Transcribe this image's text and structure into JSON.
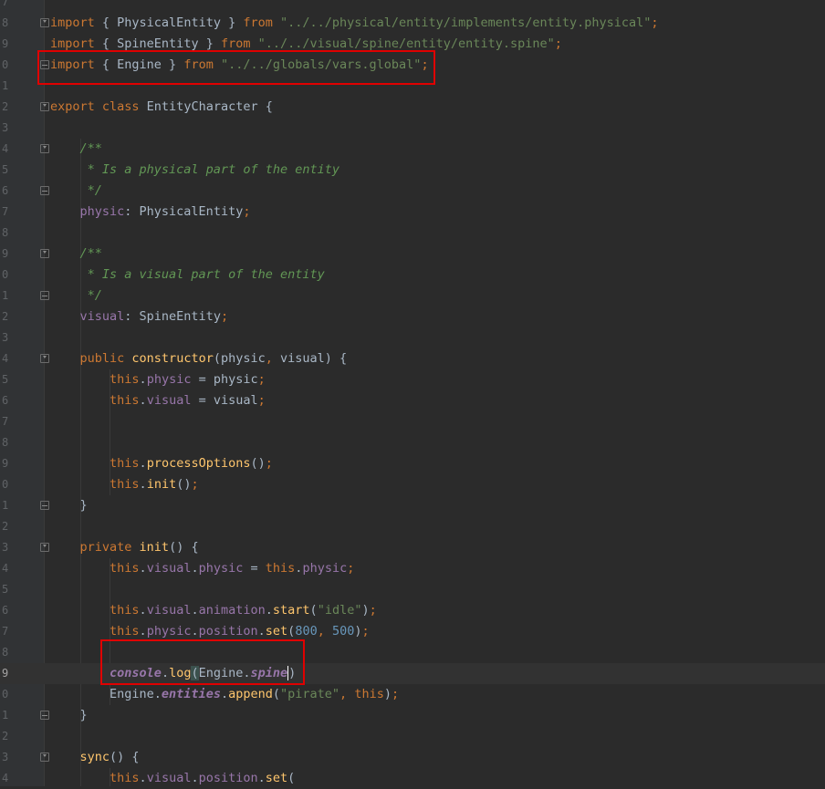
{
  "line_numbers": [
    "7",
    "8",
    "9",
    "0",
    "1",
    "2",
    "3",
    "4",
    "5",
    "6",
    "7",
    "8",
    "9",
    "0",
    "1",
    "2",
    "3",
    "4",
    "5",
    "6",
    "7",
    "8",
    "9",
    "0",
    "1",
    "2",
    "3",
    "4",
    "5",
    "6",
    "7",
    "8",
    "9",
    "0",
    "1",
    "2",
    "3",
    "4"
  ],
  "lines": [
    [],
    [
      [
        "kw",
        "import"
      ],
      [
        "txt",
        " { PhysicalEntity } "
      ],
      [
        "kw",
        "from"
      ],
      [
        "txt",
        " "
      ],
      [
        "str",
        "\"../../physical/entity/implements/entity.physical\""
      ],
      [
        "kw",
        ";"
      ]
    ],
    [
      [
        "kw",
        "import"
      ],
      [
        "txt",
        " { SpineEntity } "
      ],
      [
        "kw",
        "from"
      ],
      [
        "txt",
        " "
      ],
      [
        "str",
        "\"../../visual/spine/entity/entity.spine\""
      ],
      [
        "kw",
        ";"
      ]
    ],
    [
      [
        "kw",
        "import"
      ],
      [
        "txt",
        " { Engine } "
      ],
      [
        "kw",
        "from"
      ],
      [
        "txt",
        " "
      ],
      [
        "str",
        "\"../../globals/vars.global\""
      ],
      [
        "kw",
        ";"
      ]
    ],
    [],
    [
      [
        "kw",
        "export class"
      ],
      [
        "txt",
        " EntityCharacter {"
      ]
    ],
    [],
    [
      [
        "cm",
        "    /**"
      ]
    ],
    [
      [
        "cm",
        "     * Is a physical part of the entity"
      ]
    ],
    [
      [
        "cm",
        "     */"
      ]
    ],
    [
      [
        "fld",
        "    physic"
      ],
      [
        "txt",
        ": PhysicalEntity"
      ],
      [
        "kw",
        ";"
      ]
    ],
    [],
    [
      [
        "cm",
        "    /**"
      ]
    ],
    [
      [
        "cm",
        "     * Is a visual part of the entity"
      ]
    ],
    [
      [
        "cm",
        "     */"
      ]
    ],
    [
      [
        "fld",
        "    visual"
      ],
      [
        "txt",
        ": SpineEntity"
      ],
      [
        "kw",
        ";"
      ]
    ],
    [],
    [
      [
        "kw",
        "    public"
      ],
      [
        "txt",
        " "
      ],
      [
        "fn",
        "constructor"
      ],
      [
        "txt",
        "(physic"
      ],
      [
        "kw",
        ","
      ],
      [
        "txt",
        " visual) {"
      ]
    ],
    [
      [
        "kw",
        "        this"
      ],
      [
        "txt",
        "."
      ],
      [
        "fld",
        "physic"
      ],
      [
        "txt",
        " = physic"
      ],
      [
        "kw",
        ";"
      ]
    ],
    [
      [
        "kw",
        "        this"
      ],
      [
        "txt",
        "."
      ],
      [
        "fld",
        "visual"
      ],
      [
        "txt",
        " = visual"
      ],
      [
        "kw",
        ";"
      ]
    ],
    [],
    [],
    [
      [
        "kw",
        "        this"
      ],
      [
        "txt",
        "."
      ],
      [
        "fn",
        "processOptions"
      ],
      [
        "txt",
        "()"
      ],
      [
        "kw",
        ";"
      ]
    ],
    [
      [
        "kw",
        "        this"
      ],
      [
        "txt",
        "."
      ],
      [
        "fn",
        "init"
      ],
      [
        "txt",
        "()"
      ],
      [
        "kw",
        ";"
      ]
    ],
    [
      [
        "txt",
        "    }"
      ]
    ],
    [],
    [
      [
        "kw",
        "    private"
      ],
      [
        "txt",
        " "
      ],
      [
        "fn",
        "init"
      ],
      [
        "txt",
        "() {"
      ]
    ],
    [
      [
        "kw",
        "        this"
      ],
      [
        "txt",
        "."
      ],
      [
        "fld",
        "visual"
      ],
      [
        "txt",
        "."
      ],
      [
        "fld",
        "physic"
      ],
      [
        "txt",
        " = "
      ],
      [
        "kw",
        "this"
      ],
      [
        "txt",
        "."
      ],
      [
        "fld",
        "physic"
      ],
      [
        "kw",
        ";"
      ]
    ],
    [],
    [
      [
        "kw",
        "        this"
      ],
      [
        "txt",
        "."
      ],
      [
        "fld",
        "visual"
      ],
      [
        "txt",
        "."
      ],
      [
        "fld",
        "animation"
      ],
      [
        "txt",
        "."
      ],
      [
        "fn",
        "start"
      ],
      [
        "txt",
        "("
      ],
      [
        "str",
        "\"idle\""
      ],
      [
        "txt",
        ")"
      ],
      [
        "kw",
        ";"
      ]
    ],
    [
      [
        "kw",
        "        this"
      ],
      [
        "txt",
        "."
      ],
      [
        "fld",
        "physic"
      ],
      [
        "txt",
        "."
      ],
      [
        "fld",
        "position"
      ],
      [
        "txt",
        "."
      ],
      [
        "fn",
        "set"
      ],
      [
        "txt",
        "("
      ],
      [
        "num",
        "800"
      ],
      [
        "kw",
        ","
      ],
      [
        "txt",
        " "
      ],
      [
        "num",
        "500"
      ],
      [
        "txt",
        ")"
      ],
      [
        "kw",
        ";"
      ]
    ],
    [],
    [
      [
        "txt",
        "        "
      ],
      [
        "con",
        "console"
      ],
      [
        "txt",
        "."
      ],
      [
        "fn",
        "log"
      ],
      [
        "brk",
        "("
      ],
      [
        "txt",
        "Engine."
      ],
      [
        "ent",
        "spine"
      ],
      [
        "caret",
        ")"
      ]
    ],
    [
      [
        "txt",
        "        Engine."
      ],
      [
        "ent",
        "entities"
      ],
      [
        "txt",
        "."
      ],
      [
        "fn",
        "append"
      ],
      [
        "txt",
        "("
      ],
      [
        "str",
        "\"pirate\""
      ],
      [
        "kw",
        ","
      ],
      [
        "txt",
        " "
      ],
      [
        "kw",
        "this"
      ],
      [
        "txt",
        ")"
      ],
      [
        "kw",
        ";"
      ]
    ],
    [
      [
        "txt",
        "    }"
      ]
    ],
    [],
    [
      [
        "fn",
        "    sync"
      ],
      [
        "txt",
        "() {"
      ]
    ],
    [
      [
        "kw",
        "        this"
      ],
      [
        "txt",
        "."
      ],
      [
        "fld",
        "visual"
      ],
      [
        "txt",
        "."
      ],
      [
        "fld",
        "position"
      ],
      [
        "txt",
        "."
      ],
      [
        "fn",
        "set"
      ],
      [
        "txt",
        "("
      ]
    ]
  ]
}
